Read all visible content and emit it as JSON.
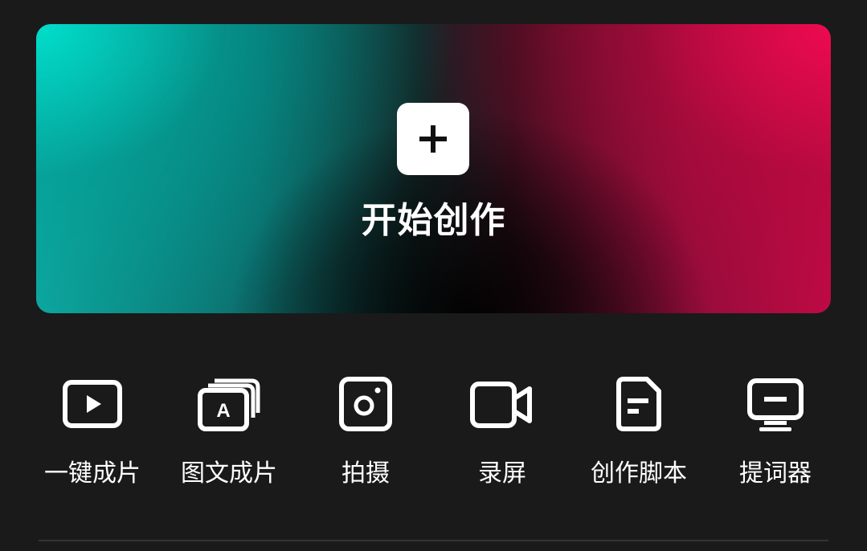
{
  "hero": {
    "label": "开始创作",
    "plus_icon": "plus-icon",
    "gradient_colors": [
      "#00e1cd",
      "#000000",
      "#f00a50"
    ]
  },
  "tools": [
    {
      "label": "一键成片",
      "icon": "play-video-icon"
    },
    {
      "label": "图文成片",
      "icon": "text-to-video-icon"
    },
    {
      "label": "拍摄",
      "icon": "camera-icon"
    },
    {
      "label": "录屏",
      "icon": "video-camera-icon"
    },
    {
      "label": "创作脚本",
      "icon": "script-document-icon"
    },
    {
      "label": "提词器",
      "icon": "teleprompter-icon"
    }
  ]
}
